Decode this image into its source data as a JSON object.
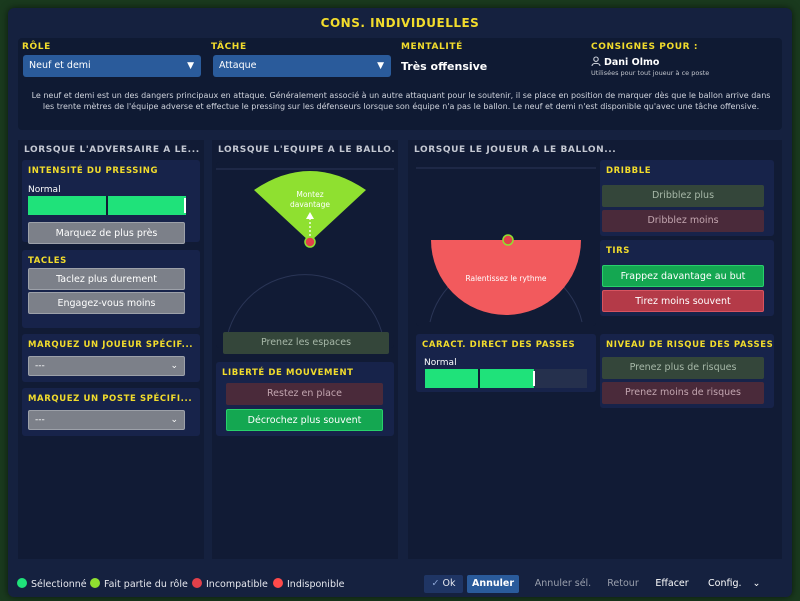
{
  "window": {
    "title": "CONS. INDIVIDUELLES"
  },
  "top": {
    "role_label": "RÔLE",
    "role_value": "Neuf et demi",
    "task_label": "TÂCHE",
    "task_value": "Attaque",
    "mentality_label": "MENTALITÉ",
    "mentality_value": "Très offensive",
    "instructions_for_label": "CONSIGNES POUR :",
    "player_name": "Dani Olmo",
    "player_sub": "Utilisées pour tout joueur à ce poste",
    "description": "Le neuf et demi est un des dangers principaux en attaque. Généralement associé à un autre attaquant pour le soutenir, il se place en position de marquer dès que le ballon arrive dans les trente mètres de l'équipe adverse et effectue le pressing sur les défenseurs lorsque son équipe n'a pas le ballon. Le neuf et demi n'est disponible qu'avec une tâche offensive."
  },
  "col1": {
    "header": "LORSQUE L'ADVERSAIRE A LE...",
    "pressing_title": "INTENSITÉ DU PRESSING",
    "pressing_level": "Normal",
    "pressing_fill": 1.0,
    "mark_closer": "Marquez de plus près",
    "tackles_title": "TACLES",
    "tackle_harder": "Taclez plus durement",
    "tackle_less": "Engagez-vous moins",
    "mark_player_title": "MARQUEZ UN JOUEUR SPÉCIF...",
    "mark_player_value": "---",
    "mark_position_title": "MARQUEZ UN POSTE SPÉCIFI...",
    "mark_position_value": "---"
  },
  "col2": {
    "header": "LORSQUE L'ÉQUIPE A LE BALLO...",
    "pitch_label_line1": "Montez",
    "pitch_label_line2": "davantage",
    "take_spaces": "Prenez les espaces",
    "freedom_title": "LIBERTÉ DE MOUVEMENT",
    "stay": "Restez en place",
    "roam": "Décrochez plus souvent"
  },
  "col3": {
    "header": "LORSQUE LE JOUEUR A LE BALLON...",
    "pitch_label": "Ralentissez le rythme",
    "dribble_title": "DRIBBLE",
    "dribble_more": "Dribblez plus",
    "dribble_less": "Dribblez moins",
    "shots_title": "TIRS",
    "shoot_more": "Frappez davantage au but",
    "shoot_less": "Tirez moins souvent",
    "passing_title": "CARACT. DIRECT DES PASSES",
    "passing_level": "Normal",
    "passing_fill": 0.67,
    "risk_title": "NIVEAU DE RISQUE DES PASSES",
    "risk_more": "Prenez plus de risques",
    "risk_less": "Prenez moins de risques"
  },
  "legend": {
    "selected": "Sélectionné",
    "part_of_role": "Fait partie du rôle",
    "incompatible": "Incompatible",
    "unavailable": "Indisponible"
  },
  "footer": {
    "ok": "Ok",
    "cancel": "Annuler",
    "cancel_sel": "Annuler sél.",
    "back": "Retour",
    "clear": "Effacer",
    "config": "Config."
  },
  "colors": {
    "accent_yellow": "#f2dc2c",
    "selected_green": "#1fe27a",
    "role_green": "#8fe030",
    "incompatible_red": "#e2404a",
    "unavailable_red": "#ff4a4a"
  },
  "icons": [
    "person-icon",
    "chevron-down-icon",
    "check-icon"
  ]
}
